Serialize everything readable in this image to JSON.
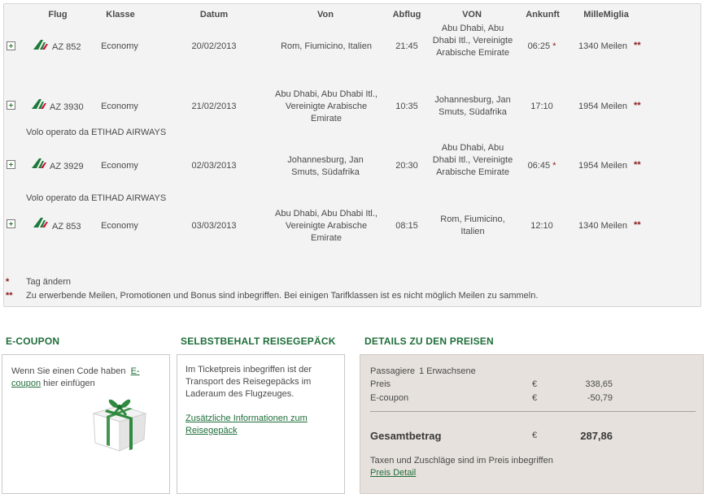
{
  "table": {
    "headers": {
      "flight": "Flug",
      "class": "Klasse",
      "date": "Datum",
      "from": "Von",
      "departure": "Abflug",
      "to": "VON",
      "arrival": "Ankunft",
      "miles": "MilleMiglia"
    },
    "rows": [
      {
        "flight": "AZ 852",
        "class": "Economy",
        "date": "20/02/2013",
        "from": "Rom, Fiumicino, Italien",
        "departure": "21:45",
        "to": "Abu Dhabi, Abu Dhabi Itl., Vereinigte Arabische Emirate",
        "arrival": "06:25",
        "arrival_star": "*",
        "miles": "1340 Meilen",
        "miles_note": "**",
        "operated_by": ""
      },
      {
        "flight": "AZ 3930",
        "class": "Economy",
        "date": "21/02/2013",
        "from": "Abu Dhabi, Abu Dhabi Itl., Vereinigte Arabische Emirate",
        "departure": "10:35",
        "to": "Johannesburg, Jan Smuts, Südafrika",
        "arrival": "17:10",
        "arrival_star": "",
        "miles": "1954 Meilen",
        "miles_note": "**",
        "operated_by": "Volo operato da ETIHAD AIRWAYS"
      },
      {
        "flight": "AZ 3929",
        "class": "Economy",
        "date": "02/03/2013",
        "from": "Johannesburg, Jan Smuts, Südafrika",
        "departure": "20:30",
        "to": "Abu Dhabi, Abu Dhabi Itl., Vereinigte Arabische Emirate",
        "arrival": "06:45",
        "arrival_star": "*",
        "miles": "1954 Meilen",
        "miles_note": "**",
        "operated_by": "Volo operato da ETIHAD AIRWAYS"
      },
      {
        "flight": "AZ 853",
        "class": "Economy",
        "date": "03/03/2013",
        "from": "Abu Dhabi, Abu Dhabi Itl., Vereinigte Arabische Emirate",
        "departure": "08:15",
        "to": "Rom, Fiumicino, Italien",
        "arrival": "12:10",
        "arrival_star": "",
        "miles": "1340 Meilen",
        "miles_note": "**",
        "operated_by": ""
      }
    ],
    "notes": [
      {
        "mark": "*",
        "text": "Tag ändern"
      },
      {
        "mark": "**",
        "text": "Zu erwerbende Meilen, Promotionen und Bonus sind inbegriffen. Bei einigen Tarifklassen ist es nicht möglich Meilen zu sammeln."
      }
    ]
  },
  "ecoupon": {
    "title": "E-COUPON",
    "text_before": "Wenn Sie einen Code haben",
    "link": "E-coupon",
    "text_after": "hier einfügen",
    "icon": "gift-icon"
  },
  "baggage": {
    "title": "SELBSTBEHALT REISEGEPÄCK",
    "text": "Im Ticketpreis inbegriffen ist der Transport des Reisegepäcks im Laderaum des Flugzeuges.",
    "link": "Zusätzliche Informationen zum Reisegepäck"
  },
  "prices": {
    "title": "DETAILS ZU DEN PREISEN",
    "passengers_label": "Passagiere",
    "passengers_value": "1 Erwachsene",
    "price_label": "Preis",
    "price_currency": "€",
    "price_value": "338,65",
    "ecoupon_label": "E-coupon",
    "ecoupon_currency": "€",
    "ecoupon_value": "-50,79",
    "total_label": "Gesamtbetrag",
    "total_currency": "€",
    "total_value": "287,86",
    "taxes_note": "Taxen und Zuschläge sind im Preis inbegriffen",
    "detail_link": "Preis Detail"
  },
  "colors": {
    "accent_green": "#1f6e3a",
    "star_red": "#8b1a1a",
    "panel_gray": "#f3f3f3",
    "price_bg": "#e6e1dc"
  },
  "icons": [
    "plus-icon",
    "alitalia-logo-icon",
    "gift-icon"
  ]
}
